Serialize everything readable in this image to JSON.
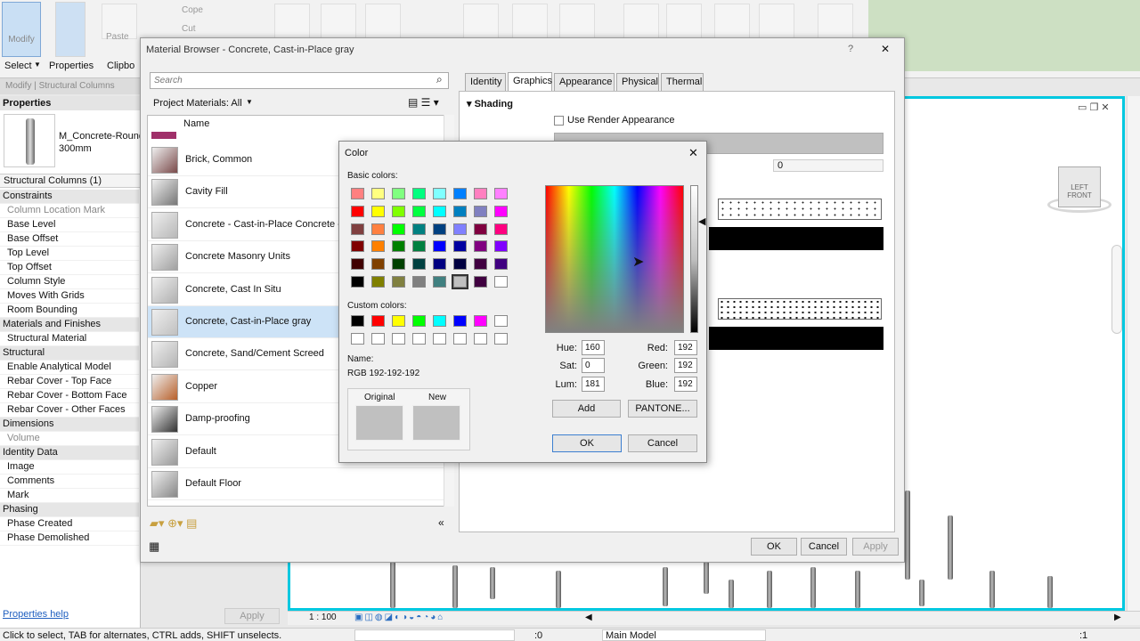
{
  "ribbon": {
    "modify_label": "Modify",
    "paste_label": "Paste",
    "cope_label": "Cope",
    "cut_label": "Cut",
    "select_label": "Select",
    "properties_label": "Properties",
    "clipboard_label": "Clipbo",
    "context_label": "Modify | Structural Columns"
  },
  "properties": {
    "title": "Properties",
    "type_name": "M_Concrete-Round",
    "type_size": "300mm",
    "selector": "Structural Columns (1)",
    "rows": [
      {
        "label": "Constraints",
        "cat": true
      },
      {
        "label": "Column Location Mark",
        "gray": true
      },
      {
        "label": "Base Level"
      },
      {
        "label": "Base Offset"
      },
      {
        "label": "Top Level"
      },
      {
        "label": "Top Offset"
      },
      {
        "label": "Column Style"
      },
      {
        "label": "Moves With Grids"
      },
      {
        "label": "Room Bounding"
      },
      {
        "label": "Materials and Finishes",
        "cat": true
      },
      {
        "label": "Structural Material"
      },
      {
        "label": "Structural",
        "cat": true
      },
      {
        "label": "Enable Analytical Model"
      },
      {
        "label": "Rebar Cover - Top Face"
      },
      {
        "label": "Rebar Cover - Bottom Face"
      },
      {
        "label": "Rebar Cover - Other Faces"
      },
      {
        "label": "Dimensions",
        "cat": true
      },
      {
        "label": "Volume",
        "gray": true
      },
      {
        "label": "Identity Data",
        "cat": true
      },
      {
        "label": "Image"
      },
      {
        "label": "Comments"
      },
      {
        "label": "Mark"
      },
      {
        "label": "Phasing",
        "cat": true
      },
      {
        "label": "Phase Created"
      },
      {
        "label": "Phase Demolished"
      }
    ],
    "help_link": "Properties help",
    "apply_label": "Apply"
  },
  "material_browser": {
    "title": "Material Browser - Concrete, Cast-in-Place gray",
    "help": "?",
    "close": "✕",
    "search_placeholder": "Search",
    "filter_label": "Project Materials: All",
    "name_header": "Name",
    "materials": [
      {
        "label": "Brick, Common",
        "color": "#7a4a4a"
      },
      {
        "label": "Cavity Fill",
        "color": "#777777"
      },
      {
        "label": "Concrete - Cast-in-Place Concrete - 3",
        "color": "#b8b8b8"
      },
      {
        "label": "Concrete Masonry Units",
        "color": "#a0a0a0"
      },
      {
        "label": "Concrete, Cast In Situ",
        "color": "#b0b0b0"
      },
      {
        "label": "Concrete, Cast-in-Place gray",
        "color": "#c0c0c0",
        "selected": true
      },
      {
        "label": "Concrete, Sand/Cement Screed",
        "color": "#b4b4b4"
      },
      {
        "label": "Copper",
        "color": "#b8602a"
      },
      {
        "label": "Damp-proofing",
        "color": "#333333"
      },
      {
        "label": "Default",
        "color": "#999999"
      },
      {
        "label": "Default Floor",
        "color": "#888888"
      }
    ],
    "tabs": [
      "Identity",
      "Graphics",
      "Appearance",
      "Physical",
      "Thermal"
    ],
    "active_tab": "Graphics",
    "section_shading": "Shading",
    "use_render_appearance": "Use Render Appearance",
    "transparency_value": "0",
    "ok_label": "OK",
    "cancel_label": "Cancel",
    "apply_label": "Apply"
  },
  "color_dialog": {
    "title": "Color",
    "close": "✕",
    "basic_colors_label": "Basic colors:",
    "basic_colors": [
      "#ff8080",
      "#ffff80",
      "#80ff80",
      "#00ff80",
      "#80ffff",
      "#0080ff",
      "#ff80c0",
      "#ff80ff",
      "#ff0000",
      "#ffff00",
      "#80ff00",
      "#00ff40",
      "#00ffff",
      "#0080c0",
      "#8080c0",
      "#ff00ff",
      "#804040",
      "#ff8040",
      "#00ff00",
      "#008080",
      "#004080",
      "#8080ff",
      "#800040",
      "#ff0080",
      "#800000",
      "#ff8000",
      "#008000",
      "#008040",
      "#0000ff",
      "#0000a0",
      "#800080",
      "#8000ff",
      "#400000",
      "#804000",
      "#004000",
      "#004040",
      "#000080",
      "#000040",
      "#400040",
      "#400080",
      "#000000",
      "#808000",
      "#808040",
      "#808080",
      "#408080",
      "#c0c0c0",
      "#400040",
      "#ffffff"
    ],
    "custom_colors_label": "Custom colors:",
    "custom_colors": [
      "#000000",
      "#ff0000",
      "#ffff00",
      "#00ff00",
      "#00ffff",
      "#0000ff",
      "#ff00ff",
      "#ffffff",
      "#ffffff",
      "#ffffff",
      "#ffffff",
      "#ffffff",
      "#ffffff",
      "#ffffff",
      "#ffffff",
      "#ffffff"
    ],
    "name_label": "Name:",
    "name_value": "RGB 192-192-192",
    "original_label": "Original",
    "new_label": "New",
    "original_color": "#c0c0c0",
    "new_color": "#c0c0c0",
    "hue_label": "Hue:",
    "hue": "160",
    "sat_label": "Sat:",
    "sat": "0",
    "lum_label": "Lum:",
    "lum": "181",
    "red_label": "Red:",
    "red": "192",
    "green_label": "Green:",
    "green": "192",
    "blue_label": "Blue:",
    "blue": "192",
    "add_label": "Add",
    "pantone_label": "PANTONE...",
    "ok_label": "OK",
    "cancel_label": "Cancel"
  },
  "viewport": {
    "scale": "1 : 100"
  },
  "status": {
    "hint": "Click to select, TAB for alternates, CTRL adds, SHIFT unselects.",
    "workset_value": ":0",
    "model_label": "Main Model",
    "filter_count": ":1"
  }
}
